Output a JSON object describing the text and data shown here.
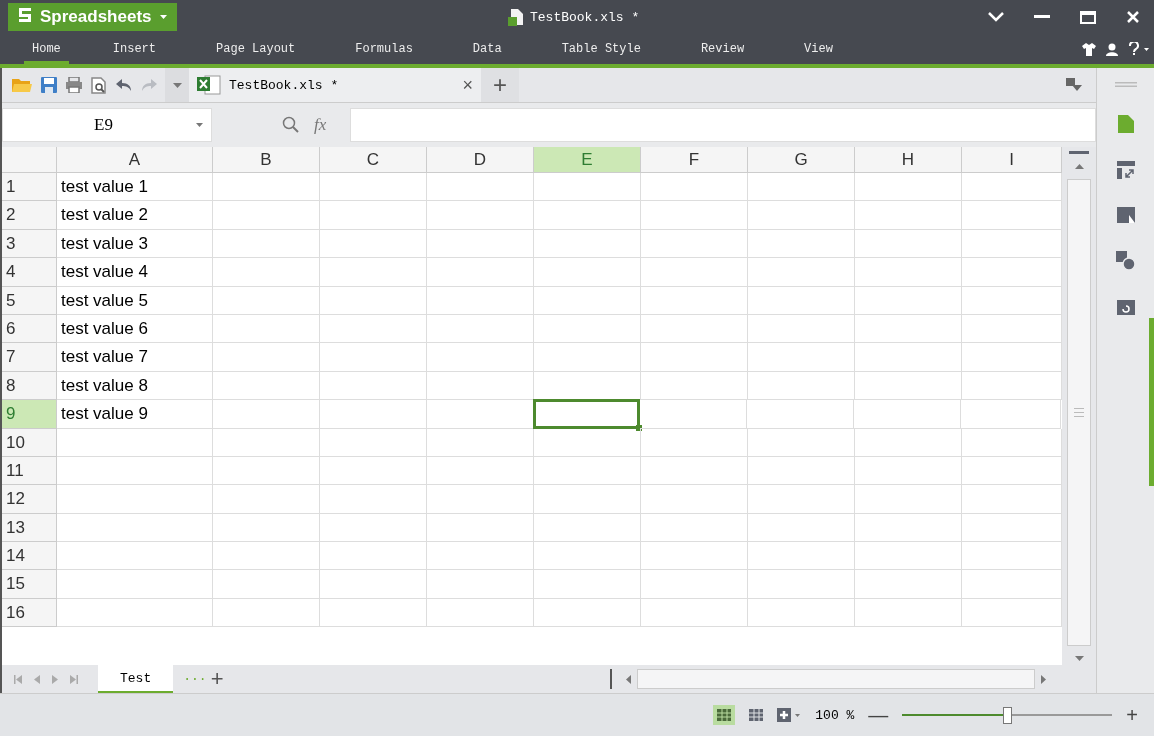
{
  "app_button": {
    "label": "Spreadsheets"
  },
  "window": {
    "title": "TestBook.xls *"
  },
  "menu_tabs": [
    {
      "label": "Home",
      "selected": true
    },
    {
      "label": "Insert",
      "selected": false
    },
    {
      "label": "Page Layout",
      "selected": false
    },
    {
      "label": "Formulas",
      "selected": false
    },
    {
      "label": "Data",
      "selected": false
    },
    {
      "label": "Table Style",
      "selected": false
    },
    {
      "label": "Review",
      "selected": false
    },
    {
      "label": "View",
      "selected": false
    }
  ],
  "document_tab": {
    "label": "TestBook.xls *",
    "close": "×",
    "add": "+"
  },
  "name_box": {
    "value": "E9"
  },
  "formula_bar": {
    "fx": "fx"
  },
  "columns": [
    {
      "label": "A",
      "selected": false
    },
    {
      "label": "B",
      "selected": false
    },
    {
      "label": "C",
      "selected": false
    },
    {
      "label": "D",
      "selected": false
    },
    {
      "label": "E",
      "selected": true
    },
    {
      "label": "F",
      "selected": false
    },
    {
      "label": "G",
      "selected": false
    },
    {
      "label": "H",
      "selected": false
    },
    {
      "label": "I",
      "selected": false
    }
  ],
  "rows": [
    {
      "label": "1",
      "selected": false,
      "cells": [
        "test value 1"
      ]
    },
    {
      "label": "2",
      "selected": false,
      "cells": [
        "test value 2"
      ]
    },
    {
      "label": "3",
      "selected": false,
      "cells": [
        "test value 3"
      ]
    },
    {
      "label": "4",
      "selected": false,
      "cells": [
        "test value 4"
      ]
    },
    {
      "label": "5",
      "selected": false,
      "cells": [
        "test value 5"
      ]
    },
    {
      "label": "6",
      "selected": false,
      "cells": [
        "test value 6"
      ]
    },
    {
      "label": "7",
      "selected": false,
      "cells": [
        "test value 7"
      ]
    },
    {
      "label": "8",
      "selected": false,
      "cells": [
        "test value 8"
      ]
    },
    {
      "label": "9",
      "selected": true,
      "cells": [
        "test value 9"
      ]
    },
    {
      "label": "10",
      "selected": false,
      "cells": []
    },
    {
      "label": "11",
      "selected": false,
      "cells": []
    },
    {
      "label": "12",
      "selected": false,
      "cells": []
    },
    {
      "label": "13",
      "selected": false,
      "cells": []
    },
    {
      "label": "14",
      "selected": false,
      "cells": []
    },
    {
      "label": "15",
      "selected": false,
      "cells": []
    },
    {
      "label": "16",
      "selected": false,
      "cells": []
    }
  ],
  "sheet_tabs": [
    {
      "label": "Test",
      "selected": true
    }
  ],
  "sheet_more": "···",
  "sheet_add": "+",
  "status_bar": {
    "zoom": "100 %",
    "minus": "—",
    "plus": "+",
    "zoom_slider": {
      "level": 0.5
    }
  }
}
